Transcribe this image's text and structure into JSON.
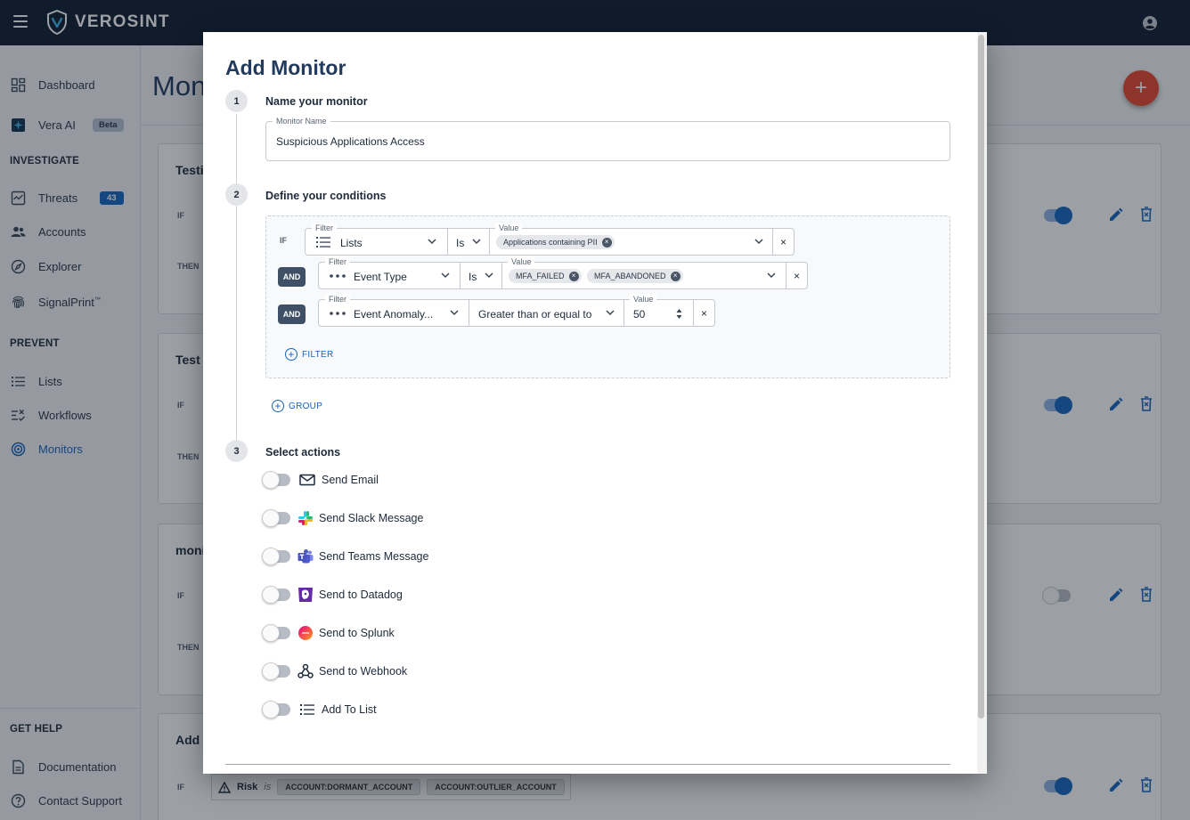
{
  "app": {
    "brand": "VEROSINT"
  },
  "sidebar": {
    "items": [
      {
        "label": "Dashboard",
        "icon": "dashboard-icon"
      },
      {
        "label": "Vera AI",
        "icon": "vera-ai-icon",
        "badge": "Beta"
      },
      {
        "label": "Threats",
        "icon": "threats-icon",
        "badge": "43"
      },
      {
        "label": "Accounts",
        "icon": "accounts-icon"
      },
      {
        "label": "Explorer",
        "icon": "compass-icon"
      },
      {
        "label": "SignalPrint",
        "icon": "fingerprint-icon",
        "trademark": "™"
      },
      {
        "label": "Lists",
        "icon": "list-icon"
      },
      {
        "label": "Workflows",
        "icon": "workflow-icon"
      },
      {
        "label": "Monitors",
        "icon": "monitor-icon",
        "active": true
      },
      {
        "label": "Documentation",
        "icon": "document-icon"
      },
      {
        "label": "Contact Support",
        "icon": "help-icon"
      }
    ],
    "sections": {
      "investigate": "INVESTIGATE",
      "prevent": "PREVENT",
      "get_help": "GET HELP"
    }
  },
  "background": {
    "page_title": "Mon",
    "cards": [
      {
        "title": "Testi",
        "if": "IF",
        "then": "THEN",
        "enabled": true
      },
      {
        "title": "Test",
        "if": "IF",
        "then": "THEN",
        "enabled": true
      },
      {
        "title": "moni",
        "if": "IF",
        "then": "THEN",
        "enabled": false
      },
      {
        "title": "Add",
        "if": "IF",
        "enabled": true
      }
    ],
    "risk_row": {
      "label": "Risk",
      "operator": "is",
      "chips": [
        "ACCOUNT:DORMANT_ACCOUNT",
        "ACCOUNT:OUTLIER_ACCOUNT"
      ]
    },
    "fab_label": "+"
  },
  "modal": {
    "title": "Add Monitor",
    "steps": [
      {
        "number": "1",
        "label": "Name your monitor"
      },
      {
        "number": "2",
        "label": "Define your conditions"
      },
      {
        "number": "3",
        "label": "Select actions"
      }
    ],
    "name_field": {
      "label": "Monitor Name",
      "value": "Suspicious Applications Access"
    },
    "conditions": {
      "if_label": "IF",
      "and_label": "AND",
      "filter_label": "Filter",
      "value_label": "Value",
      "rows": [
        {
          "filter": "Lists",
          "operator": "Is",
          "chips": [
            "Applications containing PII"
          ]
        },
        {
          "filter": "Event Type",
          "operator": "Is",
          "chips": [
            "MFA_FAILED",
            "MFA_ABANDONED"
          ]
        },
        {
          "filter": "Event Anomaly...",
          "operator": "Greater than or equal to",
          "value": "50"
        }
      ],
      "clear": "×",
      "add_filter": "FILTER",
      "add_group": "GROUP"
    },
    "actions": [
      {
        "label": "Send Email",
        "icon": "email-icon",
        "enabled": false
      },
      {
        "label": "Send Slack Message",
        "icon": "slack-icon",
        "enabled": false
      },
      {
        "label": "Send Teams Message",
        "icon": "teams-icon",
        "enabled": false
      },
      {
        "label": "Send to Datadog",
        "icon": "datadog-icon",
        "enabled": false
      },
      {
        "label": "Send to Splunk",
        "icon": "splunk-icon",
        "enabled": false
      },
      {
        "label": "Send to Webhook",
        "icon": "webhook-icon",
        "enabled": false
      },
      {
        "label": "Add To List",
        "icon": "list-icon",
        "enabled": false
      }
    ]
  },
  "colors": {
    "topbar": "#0f1b2d",
    "accent": "#1565c0",
    "fab": "#e8462c",
    "title": "#223a5e"
  }
}
